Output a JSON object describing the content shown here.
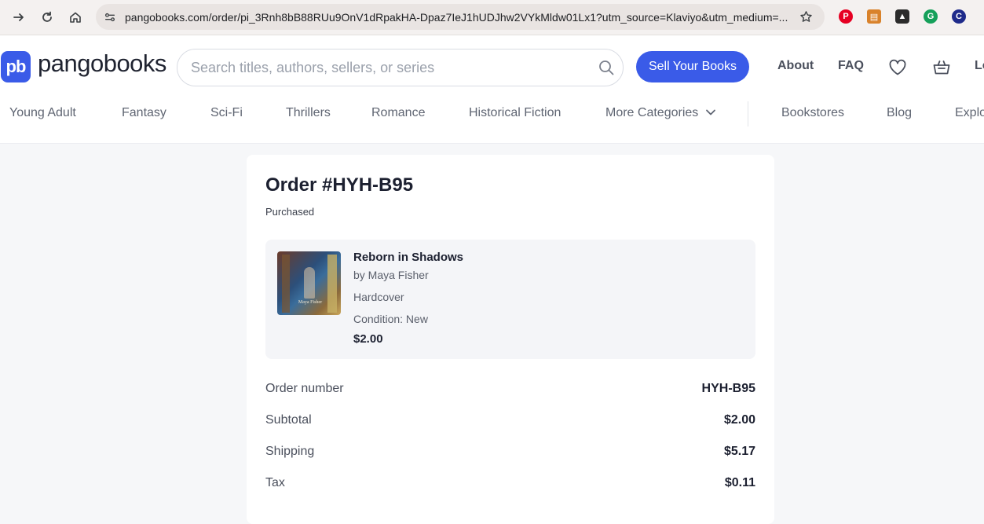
{
  "browser": {
    "url": "pangobooks.com/order/pi_3Rnh8bB88RUu9OnV1dRpakHA-Dpaz7IeJ1hUDJhw2VYkMldw01Lx1?utm_source=Klaviyo&utm_medium=...",
    "extensions": [
      "pinterest-icon",
      "chart-extension-icon",
      "artifact-extension-icon",
      "grammarly-icon",
      "circle-extension-icon"
    ]
  },
  "header": {
    "logo_mark": "pb",
    "logo_text": "pangobooks",
    "search_placeholder": "Search titles, authors, sellers, or series",
    "sell_label": "Sell Your Books",
    "about_label": "About",
    "faq_label": "FAQ",
    "login_partial": "Lo"
  },
  "categories": {
    "items": [
      "Young Adult",
      "Fantasy",
      "Sci-Fi",
      "Thrillers",
      "Romance",
      "Historical Fiction",
      "More Categories"
    ],
    "secondary": [
      "Bookstores",
      "Blog",
      "Explo"
    ]
  },
  "order": {
    "title": "Order #HYH-B95",
    "status": "Purchased",
    "item": {
      "title": "Reborn in Shadows",
      "author": "by Maya Fisher",
      "format": "Hardcover",
      "condition": "Condition: New",
      "price": "$2.00",
      "cover_author_text": "Maya Fisher"
    },
    "summary": [
      {
        "label": "Order number",
        "value": "HYH-B95"
      },
      {
        "label": "Subtotal",
        "value": "$2.00"
      },
      {
        "label": "Shipping",
        "value": "$5.17"
      },
      {
        "label": "Tax",
        "value": "$0.11"
      }
    ]
  },
  "colors": {
    "brand": "#3a5be8",
    "page_bg": "#f6f7f9",
    "card_bg": "#ffffff"
  }
}
